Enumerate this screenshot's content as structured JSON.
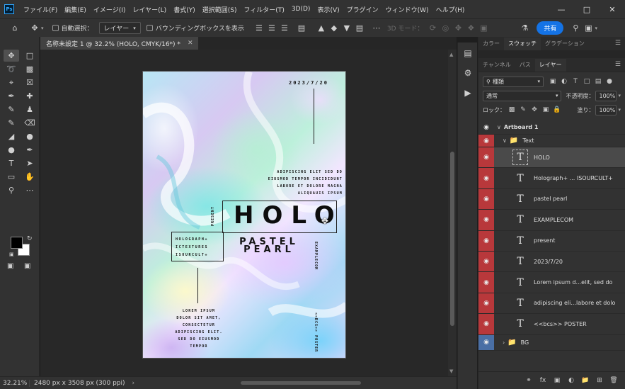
{
  "menubar": {
    "logo": "Ps",
    "items": [
      "ファイル(F)",
      "編集(E)",
      "イメージ(I)",
      "レイヤー(L)",
      "書式(Y)",
      "選択範囲(S)",
      "フィルター(T)",
      "3D(D)",
      "表示(V)",
      "プラグイン",
      "ウィンドウ(W)",
      "ヘルプ(H)"
    ]
  },
  "options": {
    "auto_select_label": "自動選択：",
    "auto_select_value": "レイヤー",
    "bounding_box_label": "バウンディングボックスを表示",
    "three_d_mode_label": "3D モード：",
    "share_label": "共有"
  },
  "document": {
    "tab_title": "名称未設定 1 @ 32.2% (HOLO, CMYK/16*) *",
    "zoom": "32.21%",
    "doc_info": "2480 px x 3508 px (300 ppi)"
  },
  "poster": {
    "date": "2023/7/20",
    "lorem_right": [
      "ADIPISCING ELIT SED DO",
      "EIUSMOD TEMPOR INCIDIDUNT",
      "LABORE ET DOLORE MAGNA",
      "ALIQUAUIS IPSUM"
    ],
    "present": "PRESENT",
    "holo": "HOLO",
    "pastel": "PASTEL",
    "pearl": "PEARL",
    "holograph": [
      "HOLOGRAPH+",
      "ICTEXTURES",
      "ISOURCULT+"
    ],
    "example": "EXAMPLECOM",
    "lorem_left": [
      "LOREM IPSUM",
      "DOLOR SIT AMET,",
      "CONSECTETUR",
      "ADIPISCING ELIT.",
      "SED DO EIUSMOD",
      "TEMPOR"
    ],
    "poster_label": "<<BCS>> POSTER"
  },
  "panels": {
    "top_tabs": [
      "カラー",
      "スウォッチ",
      "グラデーション"
    ],
    "top_active": "スウォッチ",
    "layer_tabs": [
      "チャンネル",
      "パス",
      "レイヤー"
    ],
    "layer_active": "レイヤー",
    "filter_kind": "種類",
    "blend_mode": "通常",
    "opacity_label": "不透明度：",
    "opacity_value": "100%",
    "lock_label": "ロック：",
    "fill_label": "塗り：",
    "fill_value": "100%"
  },
  "layers": {
    "artboard": "Artboard 1",
    "text_group": "Text",
    "items": [
      "HOLO",
      "Holograph+ ... ISOURCULT+",
      "pastel pearl",
      "EXAMPLECOM",
      "present",
      "2023/7/20",
      "Lorem ipsum d...elit, sed do",
      "adipiscing eli...labore et dolo",
      "<<bcs>> POSTER"
    ],
    "bg_group": "BG"
  },
  "colors": {
    "accent": "#1473e6",
    "layer_visibility_red": "#b8383b",
    "layer_visibility_blue": "#4a6fa5"
  }
}
